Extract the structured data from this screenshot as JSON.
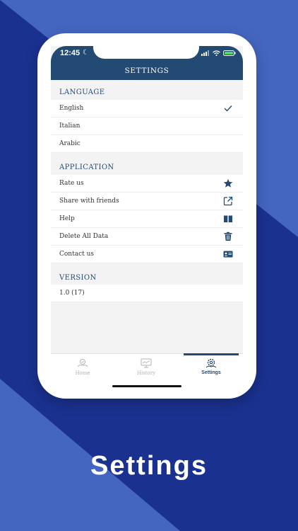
{
  "status": {
    "time": "12:45"
  },
  "header": {
    "title": "SETTINGS"
  },
  "sections": {
    "language": {
      "title": "LANGUAGE",
      "items": [
        {
          "label": "English",
          "selected": true
        },
        {
          "label": "Italian",
          "selected": false
        },
        {
          "label": "Arabic",
          "selected": false
        }
      ]
    },
    "application": {
      "title": "APPLICATION",
      "items": [
        {
          "label": "Rate us",
          "icon": "star-icon"
        },
        {
          "label": "Share with friends",
          "icon": "external-link-icon"
        },
        {
          "label": "Help",
          "icon": "book-icon"
        },
        {
          "label": "Delete All Data",
          "icon": "trash-icon"
        },
        {
          "label": "Contact us",
          "icon": "contact-card-icon"
        }
      ]
    },
    "version": {
      "title": "VERSION",
      "value": "1.0 (17)"
    }
  },
  "tabs": [
    {
      "label": "Home",
      "icon": "home-icon",
      "active": false
    },
    {
      "label": "History",
      "icon": "history-icon",
      "active": false
    },
    {
      "label": "Settings",
      "icon": "settings-icon",
      "active": true
    }
  ],
  "caption": "Settings",
  "colors": {
    "primary": "#234a73",
    "background_dark": "#1b3190",
    "background_light": "#4466c0"
  }
}
